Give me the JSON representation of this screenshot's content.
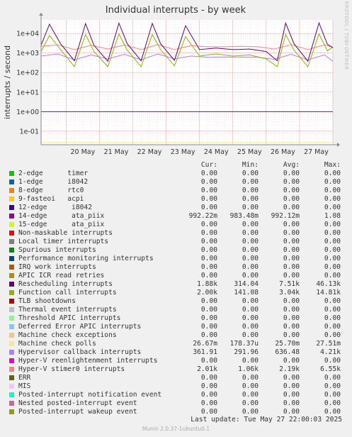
{
  "chart_data": {
    "type": "line",
    "title": "Individual interrupts - by week",
    "ylabel": "interrupts / second",
    "yscale": "log",
    "ylim": [
      0.02,
      50000
    ],
    "y_ticks": [
      "1e-01",
      "1e+00",
      "1e+01",
      "1e+02",
      "1e+03",
      "1e+04"
    ],
    "y_tick_values": [
      0.1,
      1,
      10,
      100,
      1000,
      10000
    ],
    "xlim": [
      "2025-05-19T06:00",
      "2025-05-28T00:00"
    ],
    "x_ticks": [
      "20 May",
      "21 May",
      "22 May",
      "23 May",
      "24 May",
      "25 May",
      "26 May",
      "27 May"
    ],
    "x_tick_dates": [
      "2025-05-20",
      "2025-05-21",
      "2025-05-22",
      "2025-05-23",
      "2025-05-24",
      "2025-05-25",
      "2025-05-26",
      "2025-05-27"
    ],
    "grid": true,
    "side_label": "RRDTOOL / TOBI OETIKER",
    "legend_header": {
      "cur": "Cur:",
      "min": "Min:",
      "avg": "Avg:",
      "max": "Max:"
    },
    "series": [
      {
        "name": "2-edge      timer",
        "color": "#00cc00",
        "cur": "0.00",
        "min": "0.00",
        "avg": "0.00",
        "max": "0.00"
      },
      {
        "name": "1-edge      i8042",
        "color": "#0066b3",
        "cur": "0.00",
        "min": "0.00",
        "avg": "0.00",
        "max": "0.00"
      },
      {
        "name": "8-edge      rtc0",
        "color": "#ff8000",
        "cur": "0.00",
        "min": "0.00",
        "avg": "0.00",
        "max": "0.00"
      },
      {
        "name": "9-fasteoi   acpi",
        "color": "#ffcc00",
        "cur": "0.00",
        "min": "0.00",
        "avg": "0.00",
        "max": "0.00"
      },
      {
        "name": "12-edge      i8042",
        "color": "#330099",
        "cur": "0.00",
        "min": "0.00",
        "avg": "0.00",
        "max": "0.00"
      },
      {
        "name": "14-edge      ata_piix",
        "color": "#990099",
        "cur": "992.22m",
        "min": "983.48m",
        "avg": "992.12m",
        "max": "1.08"
      },
      {
        "name": "15-edge      ata_piix",
        "color": "#ccff00",
        "cur": "0.00",
        "min": "0.00",
        "avg": "0.00",
        "max": "0.00"
      },
      {
        "name": "Non-maskable interrupts",
        "color": "#ff0000",
        "cur": "0.00",
        "min": "0.00",
        "avg": "0.00",
        "max": "0.00"
      },
      {
        "name": "Local timer interrupts",
        "color": "#808080",
        "cur": "0.00",
        "min": "0.00",
        "avg": "0.00",
        "max": "0.00"
      },
      {
        "name": "Spurious interrupts",
        "color": "#008f00",
        "cur": "0.00",
        "min": "0.00",
        "avg": "0.00",
        "max": "0.00"
      },
      {
        "name": "Performance monitoring interrupts",
        "color": "#00487d",
        "cur": "0.00",
        "min": "0.00",
        "avg": "0.00",
        "max": "0.00"
      },
      {
        "name": "IRQ work interrupts",
        "color": "#b35a00",
        "cur": "0.00",
        "min": "0.00",
        "avg": "0.00",
        "max": "0.00"
      },
      {
        "name": "APIC ICR read retries",
        "color": "#b38f00",
        "cur": "0.00",
        "min": "0.00",
        "avg": "0.00",
        "max": "0.00"
      },
      {
        "name": "Rescheduling interrupts",
        "color": "#6b006b",
        "cur": "1.88k",
        "min": "314.04",
        "avg": "7.51k",
        "max": "46.13k"
      },
      {
        "name": "Function call interrupts",
        "color": "#8fb300",
        "cur": "2.00k",
        "min": "141.08",
        "avg": "3.04k",
        "max": "14.81k"
      },
      {
        "name": "TLB shootdowns",
        "color": "#b30000",
        "cur": "0.00",
        "min": "0.00",
        "avg": "0.00",
        "max": "0.00"
      },
      {
        "name": "Thermal event interrupts",
        "color": "#bebebe",
        "cur": "0.00",
        "min": "0.00",
        "avg": "0.00",
        "max": "0.00"
      },
      {
        "name": "Threshold APIC interrupts",
        "color": "#80ff80",
        "cur": "0.00",
        "min": "0.00",
        "avg": "0.00",
        "max": "0.00"
      },
      {
        "name": "Deferred Error APIC interrupts",
        "color": "#80c9ff",
        "cur": "0.00",
        "min": "0.00",
        "avg": "0.00",
        "max": "0.00"
      },
      {
        "name": "Machine check exceptions",
        "color": "#ffc080",
        "cur": "0.00",
        "min": "0.00",
        "avg": "0.00",
        "max": "0.00"
      },
      {
        "name": "Machine check polls",
        "color": "#ffe680",
        "cur": "26.67m",
        "min": "178.37u",
        "avg": "25.70m",
        "max": "27.51m"
      },
      {
        "name": "Hypervisor callback interrupts",
        "color": "#aa80ff",
        "cur": "361.91",
        "min": "291.96",
        "avg": "636.48",
        "max": "4.21k"
      },
      {
        "name": "Hyper-V reenlightenment interrupts",
        "color": "#ee00cc",
        "cur": "0.00",
        "min": "0.00",
        "avg": "0.00",
        "max": "0.00"
      },
      {
        "name": "Hyper-V stimer0 interrupts",
        "color": "#ff8080",
        "cur": "2.01k",
        "min": "1.06k",
        "avg": "2.19k",
        "max": "6.55k"
      },
      {
        "name": "ERR",
        "color": "#666600",
        "cur": "0.00",
        "min": "0.00",
        "avg": "0.00",
        "max": "0.00"
      },
      {
        "name": "MIS",
        "color": "#ffbfff",
        "cur": "0.00",
        "min": "0.00",
        "avg": "0.00",
        "max": "0.00"
      },
      {
        "name": "Posted-interrupt notification event",
        "color": "#00ffcc",
        "cur": "0.00",
        "min": "0.00",
        "avg": "0.00",
        "max": "0.00"
      },
      {
        "name": "Nested posted-interrupt event",
        "color": "#cc6699",
        "cur": "0.00",
        "min": "0.00",
        "avg": "0.00",
        "max": "0.00"
      },
      {
        "name": "Posted-interrupt wakeup event",
        "color": "#999900",
        "cur": "0.00",
        "min": "0.00",
        "avg": "0.00",
        "max": "0.00"
      }
    ],
    "plotted_values": [
      {
        "name": "14-edge      ata_piix",
        "x": [
          "2025-05-19T06:00",
          "2025-05-28T00:00"
        ],
        "y": [
          0.992,
          0.992
        ]
      },
      {
        "name": "Machine check polls",
        "x": [
          "2025-05-19T06:00",
          "2025-05-28T00:00"
        ],
        "y": [
          0.0257,
          0.0257
        ]
      },
      {
        "name": "Hyper-V stimer0 interrupts",
        "x": [
          "2025-05-19T06:00",
          "2025-05-19T18:00",
          "2025-05-20T06:00",
          "2025-05-20T18:00",
          "2025-05-21T06:00",
          "2025-05-21T18:00",
          "2025-05-22T06:00",
          "2025-05-22T18:00",
          "2025-05-23T06:00",
          "2025-05-23T18:00",
          "2025-05-24T06:00",
          "2025-05-24T18:00",
          "2025-05-25T06:00",
          "2025-05-25T18:00",
          "2025-05-26T06:00",
          "2025-05-26T18:00",
          "2025-05-27T06:00",
          "2025-05-27T18:00",
          "2025-05-28T00:00"
        ],
        "y": [
          2200,
          2600,
          1500,
          2500,
          1600,
          2600,
          1500,
          2700,
          1500,
          2400,
          2100,
          2100,
          2200,
          2100,
          1600,
          2700,
          1500,
          2600,
          2000
        ]
      },
      {
        "name": "Hypervisor callback interrupts",
        "x": [
          "2025-05-19T06:00",
          "2025-05-19T18:00",
          "2025-05-20T06:00",
          "2025-05-20T18:00",
          "2025-05-21T06:00",
          "2025-05-21T18:00",
          "2025-05-22T06:00",
          "2025-05-22T18:00",
          "2025-05-23T06:00",
          "2025-05-23T18:00",
          "2025-05-24T06:00",
          "2025-05-24T18:00",
          "2025-05-25T06:00",
          "2025-05-25T18:00",
          "2025-05-26T06:00",
          "2025-05-26T18:00",
          "2025-05-27T06:00",
          "2025-05-27T18:00",
          "2025-05-28T00:00"
        ],
        "y": [
          700,
          900,
          450,
          800,
          500,
          850,
          450,
          900,
          500,
          700,
          600,
          620,
          620,
          600,
          480,
          850,
          450,
          800,
          380
        ]
      },
      {
        "name": "Function call interrupts",
        "x": [
          "2025-05-19T06:00",
          "2025-05-19T12:00",
          "2025-05-19T20:00",
          "2025-05-20T06:00",
          "2025-05-20T14:00",
          "2025-05-20T20:00",
          "2025-05-21T06:00",
          "2025-05-21T14:00",
          "2025-05-21T20:00",
          "2025-05-22T06:00",
          "2025-05-22T14:00",
          "2025-05-22T20:00",
          "2025-05-23T06:00",
          "2025-05-23T14:00",
          "2025-05-24T00:00",
          "2025-05-24T12:00",
          "2025-05-25T00:00",
          "2025-05-25T12:00",
          "2025-05-26T00:00",
          "2025-05-26T08:00",
          "2025-05-26T14:00",
          "2025-05-26T20:00",
          "2025-05-27T06:00",
          "2025-05-27T14:00",
          "2025-05-27T20:00",
          "2025-05-28T00:00"
        ],
        "y": [
          1200,
          8000,
          1500,
          200,
          9000,
          1200,
          200,
          9500,
          1400,
          200,
          9000,
          1500,
          220,
          7000,
          700,
          900,
          700,
          800,
          500,
          200,
          9000,
          1400,
          200,
          9500,
          1300,
          2000
        ]
      },
      {
        "name": "Rescheduling interrupts",
        "x": [
          "2025-05-19T06:00",
          "2025-05-19T12:00",
          "2025-05-19T20:00",
          "2025-05-20T06:00",
          "2025-05-20T14:00",
          "2025-05-20T20:00",
          "2025-05-21T06:00",
          "2025-05-21T14:00",
          "2025-05-21T20:00",
          "2025-05-22T06:00",
          "2025-05-22T14:00",
          "2025-05-22T20:00",
          "2025-05-23T06:00",
          "2025-05-23T14:00",
          "2025-05-24T00:00",
          "2025-05-24T12:00",
          "2025-05-25T00:00",
          "2025-05-25T12:00",
          "2025-05-26T00:00",
          "2025-05-26T08:00",
          "2025-05-26T14:00",
          "2025-05-26T20:00",
          "2025-05-27T06:00",
          "2025-05-27T14:00",
          "2025-05-27T20:00",
          "2025-05-28T00:00"
        ],
        "y": [
          2500,
          30000,
          3000,
          400,
          32000,
          2500,
          380,
          34000,
          3000,
          400,
          33000,
          3000,
          420,
          25000,
          1500,
          1800,
          1500,
          1600,
          1200,
          400,
          34000,
          3000,
          380,
          35000,
          2800,
          1900
        ]
      }
    ]
  },
  "last_update": "Last update: Tue May 27 22:00:03 2025",
  "footer": "Munin 2.0.37-1ubuntu0.1"
}
